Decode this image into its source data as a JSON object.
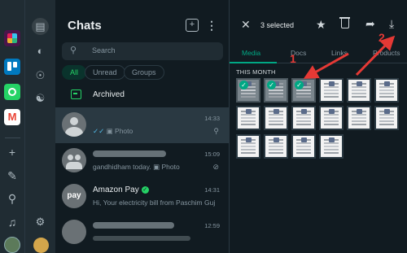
{
  "dock": {
    "apps": [
      "slack-icon",
      "trello-icon",
      "whatsapp-icon",
      "gmail-icon"
    ],
    "buttons": [
      "add-icon",
      "extensions-icon",
      "search-icon",
      "bell-icon"
    ]
  },
  "chat_list": {
    "title": "Chats",
    "search_placeholder": "Search",
    "filters": [
      "All",
      "Unread",
      "Groups"
    ],
    "archived_label": "Archived",
    "rows": [
      {
        "name": "",
        "preview": "Photo",
        "time": "14:33",
        "pinned": true
      },
      {
        "name": "",
        "preview": "gandhidham today.",
        "preview_suffix": "Photo",
        "time": "15:09"
      },
      {
        "name": "Amazon Pay",
        "preview": "Hi, Your electricity bill from Paschim Guj...",
        "time": "14:31",
        "avatar_text": "pay"
      },
      {
        "name": "",
        "preview": "",
        "time": "12:59"
      }
    ]
  },
  "media_pane": {
    "selected_text": "3 selected",
    "tabs": [
      "Media",
      "Docs",
      "Links",
      "Products"
    ],
    "section_label": "THIS MONTH"
  },
  "annotations": {
    "one": "1",
    "two": "2"
  },
  "colors": {
    "accent": "#00a884",
    "arrow": "#e53935"
  }
}
